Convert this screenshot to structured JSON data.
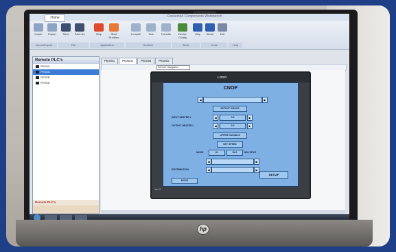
{
  "window": {
    "app_tab": "Home",
    "title": "Connected Components Workbench"
  },
  "ribbon": {
    "buttons": [
      {
        "label": "Import",
        "icon": "import-icon",
        "color": "#8fa3c4"
      },
      {
        "label": "Export",
        "icon": "export-icon",
        "color": "#8fa3c4"
      },
      {
        "label": "Save",
        "icon": "save-icon",
        "color": "#3f4f70"
      },
      {
        "label": "Save As",
        "icon": "save-as-icon",
        "color": "#3f4f70"
      },
      {
        "label": "Stop",
        "icon": "stop-icon",
        "color": "#e04a2c"
      },
      {
        "label": "Start Runtime",
        "icon": "start-runtime-icon",
        "color": "#e8783a"
      },
      {
        "label": "Compile",
        "icon": "compile-icon",
        "color": "#9fb2cc"
      },
      {
        "label": "Test",
        "icon": "test-icon",
        "color": "#9fb2cc"
      },
      {
        "label": "Transfer",
        "icon": "transfer-icon",
        "color": "#9fb2cc"
      },
      {
        "label": "Device Config",
        "icon": "device-config-icon",
        "color": "#4c8a3e"
      },
      {
        "label": "Help",
        "icon": "help-icon",
        "color": "#2f5fb0"
      },
      {
        "label": "About",
        "icon": "about-icon",
        "color": "#2f5fb0"
      },
      {
        "label": "Exit",
        "icon": "exit-icon",
        "color": "#7a8aa6"
      }
    ],
    "groups": [
      "Import/Export",
      "File",
      "Application",
      "Runtime",
      "Build",
      "Tools",
      "Help"
    ]
  },
  "left_panel": {
    "title": "Remote PLC's",
    "items": [
      "PESSC",
      "PESDIL",
      "PESSB",
      "PESSD"
    ],
    "selected_index": 1,
    "footer_title": "Remote PLC's"
  },
  "doc_tabs": [
    "PESSC",
    "PESDIL",
    "PESSB",
    "PESSD"
  ],
  "active_tab_index": 1,
  "toolbar": {
    "dropdown_value": "Remote Navigation"
  },
  "hmi": {
    "logo": "LOGO",
    "title": "CNOP",
    "buttons": {
      "setpoint": "SETPNT GROUP",
      "value1": "0.0",
      "value2": "0.0",
      "option": "UPPER RUN/IDLE",
      "save": "SET SPEED",
      "add": "MULTIPLE",
      "prev": "MODE",
      "setup": "SETUP"
    },
    "labels": {
      "input_heater": "INPUT HEATER L",
      "output_heater": "OUTPUT HEATER L",
      "mode_lbl": "MODE",
      "distribution": "DISTRIBUTION",
      "k1": "K1",
      "k2": "DLS"
    },
    "footer": "Ver 2"
  },
  "colors": {
    "frame": "#1f3f86",
    "hmi_screen": "#7fb0e3",
    "selection": "#3c7bd6"
  }
}
